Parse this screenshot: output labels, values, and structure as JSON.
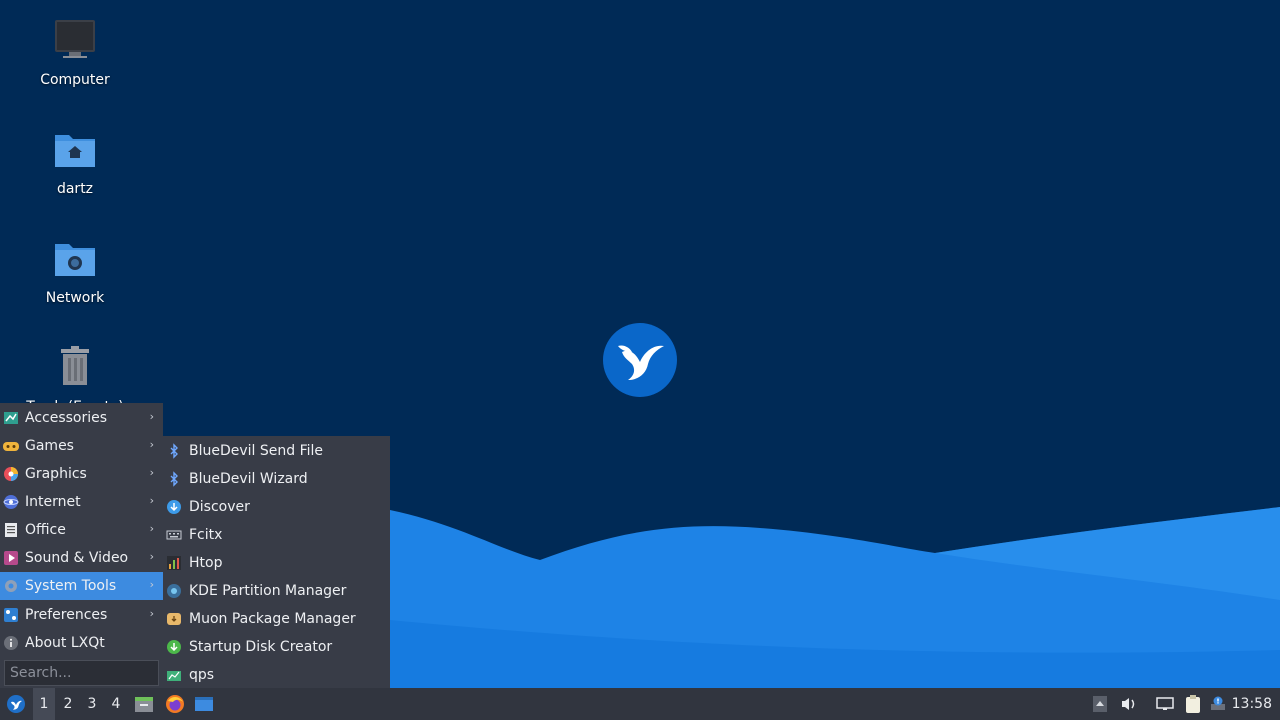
{
  "desktop": {
    "icons": [
      {
        "label": "Computer",
        "icon": "computer-icon"
      },
      {
        "label": "dartz",
        "icon": "home-folder-icon"
      },
      {
        "label": "Network",
        "icon": "network-folder-icon"
      },
      {
        "label": "Trash (Empty)",
        "icon": "trash-icon"
      }
    ]
  },
  "main_menu": {
    "items": [
      {
        "label": "Accessories",
        "icon": "accessories-icon",
        "has_submenu": true
      },
      {
        "label": "Games",
        "icon": "games-icon",
        "has_submenu": true
      },
      {
        "label": "Graphics",
        "icon": "graphics-icon",
        "has_submenu": true
      },
      {
        "label": "Internet",
        "icon": "internet-icon",
        "has_submenu": true
      },
      {
        "label": "Office",
        "icon": "office-icon",
        "has_submenu": true
      },
      {
        "label": "Sound & Video",
        "icon": "sound-video-icon",
        "has_submenu": true
      },
      {
        "label": "System Tools",
        "icon": "system-tools-icon",
        "has_submenu": true,
        "active": true
      },
      {
        "label": "Preferences",
        "icon": "preferences-icon",
        "has_submenu": true
      },
      {
        "label": "About LXQt",
        "icon": "about-icon",
        "has_submenu": false
      }
    ],
    "search_placeholder": "Search...",
    "arrow": "›"
  },
  "sub_menu": {
    "items": [
      {
        "label": "BlueDevil Send File",
        "icon": "bluetooth-icon"
      },
      {
        "label": "BlueDevil Wizard",
        "icon": "bluetooth-icon"
      },
      {
        "label": "Discover",
        "icon": "discover-icon"
      },
      {
        "label": "Fcitx",
        "icon": "keyboard-icon"
      },
      {
        "label": "Htop",
        "icon": "htop-icon"
      },
      {
        "label": "KDE Partition Manager",
        "icon": "partition-manager-icon"
      },
      {
        "label": "Muon Package Manager",
        "icon": "package-manager-icon"
      },
      {
        "label": "Startup Disk Creator",
        "icon": "startup-disk-icon"
      },
      {
        "label": "qps",
        "icon": "qps-icon"
      }
    ]
  },
  "taskbar": {
    "desktops": [
      "1",
      "2",
      "3",
      "4"
    ],
    "active_desktop": "1",
    "clock": "13:58"
  },
  "colors": {
    "wallpaper": "#002a56",
    "menu_bg": "#383c47",
    "highlight": "#3d8be0",
    "taskbar_bg": "#31353f"
  }
}
